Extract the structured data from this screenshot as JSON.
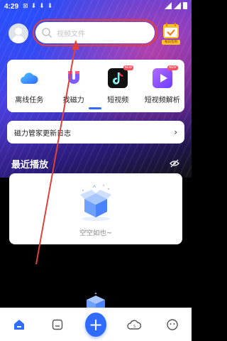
{
  "status_bar": {
    "time": "4:29"
  },
  "search": {
    "placeholder": "视频文件"
  },
  "checkin": {
    "label": "每日签到"
  },
  "features": [
    {
      "label": "离线任务",
      "icon": "cloud-icon"
    },
    {
      "label": "找磁力",
      "icon": "magnet-icon"
    },
    {
      "label": "短视频",
      "icon": "tiktok-icon",
      "badge": "NEW"
    },
    {
      "label": "短视频解析",
      "icon": "play-icon",
      "badge": "NEW"
    }
  ],
  "log_card": {
    "label": "磁力管家更新日志"
  },
  "recent": {
    "title": "最近播放",
    "empty_text": "空空如也~"
  },
  "bottom_nav": [
    "home-icon",
    "file-icon",
    "plus-icon",
    "cloud-icon",
    "smile-icon"
  ],
  "colors": {
    "accent": "#2f6bff",
    "annotation": "#e0403a"
  }
}
